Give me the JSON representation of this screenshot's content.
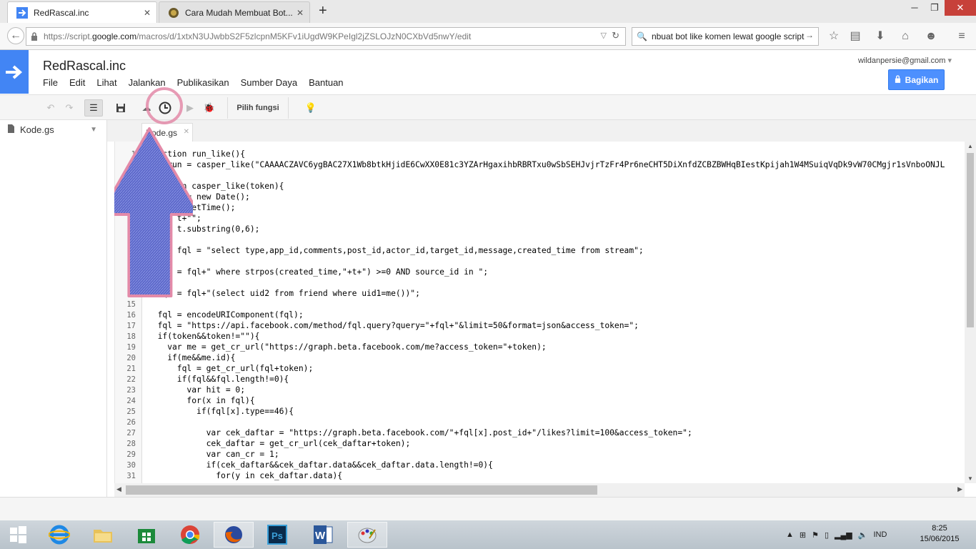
{
  "browser": {
    "tabs": [
      {
        "title": "RedRascal.inc",
        "active": true
      },
      {
        "title": "Cara Mudah Membuat Bot...",
        "active": false
      }
    ],
    "url_prefix": "https://script.",
    "url_domain": "google.com",
    "url_path": "/macros/d/1xtxN3UJwbbS2F5zlcpnM5KFv1iUgdW9KPeIgl2jZSLOJzN0CXbVd5nwY/edit",
    "search_text": "nbuat bot like komen lewat google script"
  },
  "app": {
    "project_title": "RedRascal.inc",
    "menu": [
      "File",
      "Edit",
      "Lihat",
      "Jalankan",
      "Publikasikan",
      "Sumber Daya",
      "Bantuan"
    ],
    "user_email": "wildanpersie@gmail.com",
    "share_label": "Bagikan",
    "function_select": "Pilih fungsi",
    "sidebar_file": "Kode.gs",
    "editor_tab": "Kode.gs",
    "accent": "#4285f4"
  },
  "editor": {
    "line_numbers": [
      "1",
      "2",
      "3",
      "4",
      "5",
      "6",
      "7",
      "8",
      "9",
      "10",
      "11",
      "12",
      "13",
      "14",
      "15",
      "16",
      "17",
      "18",
      "19",
      "20",
      "21",
      "22",
      "23",
      "24",
      "25",
      "26",
      "27",
      "28",
      "29",
      "30",
      "31"
    ],
    "lines": [
      "function run_like(){",
      "var run = casper_like(\"CAAAACZAVC6ygBAC27X1Wb8btkHjidE6CwXX0E81c3YZArHgaxihbRBRTxu0wSbSEHJvjrTzFr4Pr6neCHT5DiXnfdZCBZBWHqBIestKpijah1W4MSuiqVqDk9vW70CMgjr1sVnboONJL",
      "",
      "function casper_like(token){",
      "  var t = new Date();",
      "  t = t.getTime();",
      "  t = t+\"\";",
      "  t = t.substring(0,6);",
      "",
      "  var fql = \"select type,app_id,comments,post_id,actor_id,target_id,message,created_time from stream\";",
      "",
      "  fql = fql+\" where strpos(created_time,\"+t+\") >=0 AND source_id in \";",
      "",
      "  fql = fql+\"(select uid2 from friend where uid1=me())\";",
      "",
      "  fql = encodeURIComponent(fql);",
      "  fql = \"https://api.facebook.com/method/fql.query?query=\"+fql+\"&limit=50&format=json&access_token=\";",
      "  if(token&&token!=\"\"){",
      "    var me = get_cr_url(\"https://graph.beta.facebook.com/me?access_token=\"+token);",
      "    if(me&&me.id){",
      "      fql = get_cr_url(fql+token);",
      "      if(fql&&fql.length!=0){",
      "        var hit = 0;",
      "        for(x in fql){",
      "          if(fql[x].type==46){",
      "",
      "            var cek_daftar = \"https://graph.beta.facebook.com/\"+fql[x].post_id+\"/likes?limit=100&access_token=\";",
      "            cek_daftar = get_cr_url(cek_daftar+token);",
      "            var can_cr = 1;",
      "            if(cek_daftar&&cek_daftar.data&&cek_daftar.data.length!=0){",
      "              for(y in cek_daftar.data){"
    ]
  },
  "taskbar": {
    "apps": [
      "start-button",
      "internet-explorer",
      "file-explorer",
      "store",
      "chrome",
      "firefox",
      "photoshop",
      "word",
      "paint"
    ],
    "lang": "IND",
    "time": "8:25",
    "date": "15/06/2015"
  }
}
